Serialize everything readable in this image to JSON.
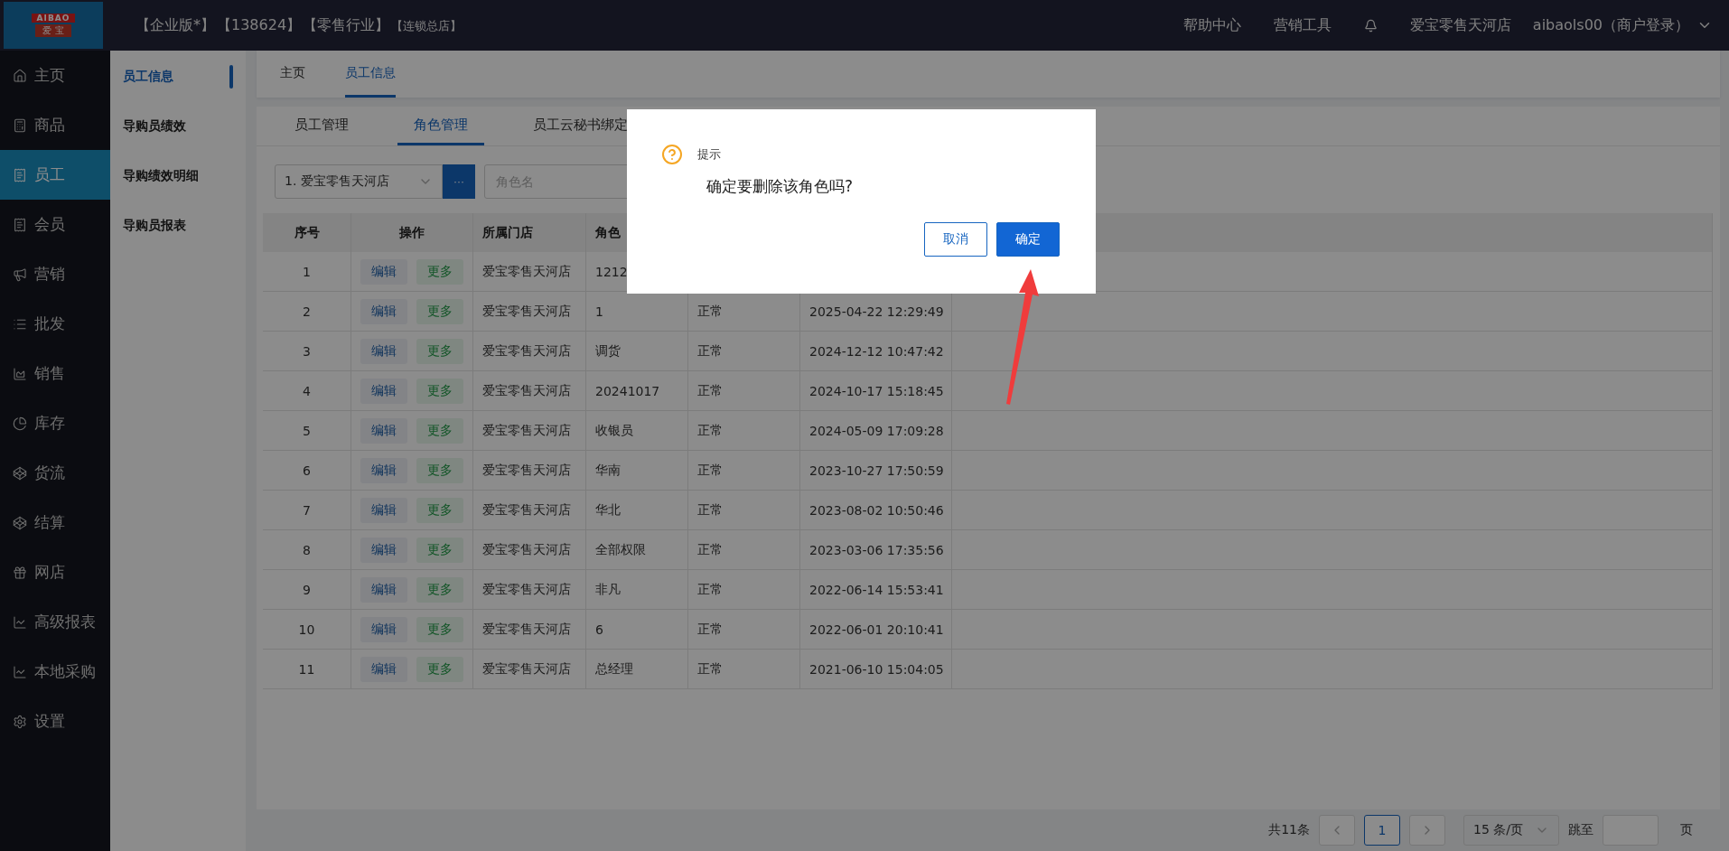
{
  "top_bar": {
    "logo": {
      "text": "AIBAO",
      "subtext": "爱 宝"
    },
    "tags": [
      {
        "text": "【企业版*】",
        "kind": "large"
      },
      {
        "text": "【138624】",
        "kind": "large"
      },
      {
        "text": "【零售行业】",
        "kind": "large"
      },
      {
        "text": "【连锁总店】",
        "kind": "small"
      }
    ],
    "links": [
      "帮助中心",
      "营销工具"
    ],
    "store": "爱宝零售天河店",
    "user": "aibaols00（商户登录）"
  },
  "sidebar": {
    "items": [
      {
        "label": "主页",
        "selected": false
      },
      {
        "label": "商品",
        "selected": false
      },
      {
        "label": "员工",
        "selected": true
      },
      {
        "label": "会员",
        "selected": false
      },
      {
        "label": "营销",
        "selected": false
      },
      {
        "label": "批发",
        "selected": false
      },
      {
        "label": "销售",
        "selected": false
      },
      {
        "label": "库存",
        "selected": false
      },
      {
        "label": "货流",
        "selected": false
      },
      {
        "label": "结算",
        "selected": false
      },
      {
        "label": "网店",
        "selected": false
      },
      {
        "label": "高级报表",
        "selected": false
      },
      {
        "label": "本地采购",
        "selected": false
      },
      {
        "label": "设置",
        "selected": false
      }
    ]
  },
  "submenu": {
    "items": [
      {
        "label": "员工信息",
        "selected": true
      },
      {
        "label": "导购员绩效",
        "selected": false
      },
      {
        "label": "导购绩效明细",
        "selected": false
      },
      {
        "label": "导购员报表",
        "selected": false
      }
    ]
  },
  "page_tabs": [
    {
      "label": "主页",
      "selected": false
    },
    {
      "label": "员工信息",
      "selected": true
    }
  ],
  "tabs": [
    {
      "label": "员工管理",
      "selected": false
    },
    {
      "label": "角色管理",
      "selected": true
    },
    {
      "label": "员工云秘书绑定",
      "selected": false
    }
  ],
  "filters": {
    "store_select": "1. 爱宝零售天河店",
    "more_button": "···",
    "role_name": {
      "placeholder": "角色名"
    }
  },
  "table": {
    "columns": [
      "序号",
      "操作",
      "所属门店",
      "角色"
    ],
    "rows": [
      {
        "no": "1",
        "actions": [
          "编辑",
          "更多"
        ],
        "store": "爱宝零售天河店",
        "role": "1212"
      },
      {
        "no": "2",
        "actions": [
          "编辑",
          "更多"
        ],
        "store": "爱宝零售天河店",
        "role": "1",
        "status": "正常",
        "created": "2025-04-22 12:29:49"
      },
      {
        "no": "3",
        "actions": [
          "编辑",
          "更多"
        ],
        "store": "爱宝零售天河店",
        "role": "调货",
        "status": "正常",
        "created": "2024-12-12 10:47:42"
      },
      {
        "no": "4",
        "actions": [
          "编辑",
          "更多"
        ],
        "store": "爱宝零售天河店",
        "role": "20241017",
        "status": "正常",
        "created": "2024-10-17 15:18:45"
      },
      {
        "no": "5",
        "actions": [
          "编辑",
          "更多"
        ],
        "store": "爱宝零售天河店",
        "role": "收银员",
        "status": "正常",
        "created": "2024-05-09 17:09:28"
      },
      {
        "no": "6",
        "actions": [
          "编辑",
          "更多"
        ],
        "store": "爱宝零售天河店",
        "role": "华南",
        "status": "正常",
        "created": "2023-10-27 17:50:59"
      },
      {
        "no": "7",
        "actions": [
          "编辑",
          "更多"
        ],
        "store": "爱宝零售天河店",
        "role": "华北",
        "status": "正常",
        "created": "2023-08-02 10:50:46"
      },
      {
        "no": "8",
        "actions": [
          "编辑",
          "更多"
        ],
        "store": "爱宝零售天河店",
        "role": "全部权限",
        "status": "正常",
        "created": "2023-03-06 17:35:56"
      },
      {
        "no": "9",
        "actions": [
          "编辑",
          "更多"
        ],
        "store": "爱宝零售天河店",
        "role": "非凡",
        "status": "正常",
        "created": "2022-06-14 15:53:41"
      },
      {
        "no": "10",
        "actions": [
          "编辑",
          "更多"
        ],
        "store": "爱宝零售天河店",
        "role": "6",
        "status": "正常",
        "created": "2022-06-01 20:10:41"
      },
      {
        "no": "11",
        "actions": [
          "编辑",
          "更多"
        ],
        "store": "爱宝零售天河店",
        "role": "总经理",
        "status": "正常",
        "created": "2021-06-10 15:04:05"
      }
    ]
  },
  "pagination": {
    "total": "共11条",
    "pages": [
      {
        "label": "1",
        "selected": true
      }
    ],
    "page_size": "15 条/页",
    "jump_label": "跳至",
    "page_unit": "页"
  },
  "dialog": {
    "title": "提示",
    "message": "确定要删除该角色吗?",
    "buttons": [
      {
        "label": "取消",
        "kind": "secondary"
      },
      {
        "label": "确定",
        "kind": "primary"
      }
    ]
  }
}
